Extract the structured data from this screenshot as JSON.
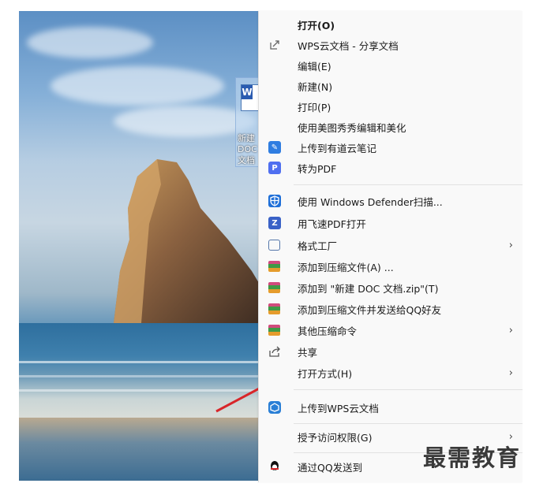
{
  "desktop": {
    "icon_label": "新建 DOC 文档"
  },
  "menu": {
    "items": [
      {
        "label": "打开(O)",
        "icon": "none",
        "bold": true
      },
      {
        "label": "WPS云文档 - 分享文档",
        "icon": "share-out-icon"
      },
      {
        "label": "编辑(E)",
        "icon": "none"
      },
      {
        "label": "新建(N)",
        "icon": "none"
      },
      {
        "label": "打印(P)",
        "icon": "none"
      },
      {
        "label": "使用美图秀秀编辑和美化",
        "icon": "none"
      },
      {
        "label": "上传到有道云笔记",
        "icon": "youdao-note-icon"
      },
      {
        "label": "转为PDF",
        "icon": "pdf-convert-icon"
      },
      {
        "label": "使用 Windows Defender扫描...",
        "icon": "defender-shield-icon"
      },
      {
        "label": "用飞速PDF打开",
        "icon": "feisu-pdf-icon"
      },
      {
        "label": "格式工厂",
        "icon": "format-factory-icon",
        "submenu": true
      },
      {
        "label": "添加到压缩文件(A) ...",
        "icon": "winrar-icon"
      },
      {
        "label": "添加到 \"新建 DOC 文档.zip\"(T)",
        "icon": "winrar-icon"
      },
      {
        "label": "添加到压缩文件并发送给QQ好友",
        "icon": "winrar-icon"
      },
      {
        "label": "其他压缩命令",
        "icon": "winrar-icon",
        "submenu": true
      },
      {
        "label": "共享",
        "icon": "share-icon"
      },
      {
        "label": "打开方式(H)",
        "icon": "none",
        "submenu": true
      },
      {
        "label": "上传到WPS云文档",
        "icon": "wps-cloud-icon"
      },
      {
        "label": "授予访问权限(G)",
        "icon": "none",
        "submenu": true
      },
      {
        "label": "通过QQ发送到",
        "icon": "qq-icon"
      }
    ],
    "chevron": "›"
  },
  "watermark": "最需教育"
}
